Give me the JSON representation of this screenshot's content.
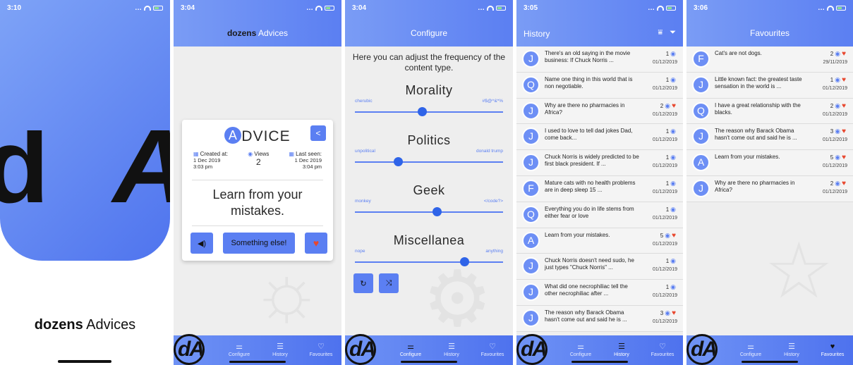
{
  "phone1": {
    "time": "3:10",
    "brand_bold": "dozens",
    "brand_rest": " Advices",
    "big_letters": [
      "d",
      "A"
    ]
  },
  "phone2": {
    "time": "3:04",
    "title_bold": "dozens",
    "title_rest": " Advices",
    "card": {
      "title_initial": "A",
      "title_rest": "DVICE",
      "created_label": "Created at:",
      "created_value_1": "1 Dec 2019",
      "created_value_2": "3:03 pm",
      "views_label": "Views",
      "views_value": "2",
      "last_seen_label": "Last seen:",
      "last_seen_value_1": "1 Dec 2019",
      "last_seen_value_2": "3:04 pm",
      "advice_text": "Learn from your mistakes.",
      "something_else": "Something else!"
    }
  },
  "phone3": {
    "time": "3:04",
    "title": "Configure",
    "intro": "Here you can adjust the frequency of the content type.",
    "sliders": [
      {
        "name": "Morality",
        "low": "cherubic",
        "high": "#$@^&*%",
        "value": 0.45
      },
      {
        "name": "Politics",
        "low": "unpolitical",
        "high": "donald trump",
        "value": 0.29
      },
      {
        "name": "Geek",
        "low": "monkey",
        "high": "</code?>",
        "value": 0.55
      },
      {
        "name": "Miscellanea",
        "low": "nope",
        "high": "anything",
        "value": 0.74
      }
    ]
  },
  "phone4": {
    "time": "3:05",
    "title": "History",
    "items": [
      {
        "initial": "J",
        "text": "There's an old saying in the movie business: If Chuck Norris ...",
        "count": "1",
        "fav": false,
        "date": "01/12/2019"
      },
      {
        "initial": "Q",
        "text": "Name one thing in this world that is non negotiable.",
        "count": "1",
        "fav": false,
        "date": "01/12/2019"
      },
      {
        "initial": "J",
        "text": "Why are there no pharmacies in Africa?",
        "count": "2",
        "fav": true,
        "date": "01/12/2019"
      },
      {
        "initial": "J",
        "text": "I used to love to tell dad jokes Dad, come back...",
        "count": "1",
        "fav": false,
        "date": "01/12/2019"
      },
      {
        "initial": "J",
        "text": "Chuck Norris is widely predicted to be first black president. If ...",
        "count": "1",
        "fav": false,
        "date": "01/12/2019"
      },
      {
        "initial": "F",
        "text": "Mature cats with no health problems are in deep sleep 15 ...",
        "count": "1",
        "fav": false,
        "date": "01/12/2019"
      },
      {
        "initial": "Q",
        "text": "Everything you do in life stems from either fear or love",
        "count": "1",
        "fav": false,
        "date": "01/12/2019"
      },
      {
        "initial": "A",
        "text": "Learn from your mistakes.",
        "count": "5",
        "fav": true,
        "date": "01/12/2019"
      },
      {
        "initial": "J",
        "text": "Chuck Norris doesn't need sudo, he just types \"Chuck Norris\" ...",
        "count": "1",
        "fav": false,
        "date": "01/12/2019"
      },
      {
        "initial": "J",
        "text": "What did one necrophiliac tell the other necrophiliac after ...",
        "count": "1",
        "fav": false,
        "date": "01/12/2019"
      },
      {
        "initial": "J",
        "text": "The reason why Barack Obama hasn't come out and said he is ...",
        "count": "3",
        "fav": true,
        "date": "01/12/2019"
      }
    ]
  },
  "phone5": {
    "time": "3:06",
    "title": "Favourites",
    "items": [
      {
        "initial": "F",
        "text": "Cat's are not dogs.",
        "count": "2",
        "date": "29/11/2019"
      },
      {
        "initial": "J",
        "text": "Little known fact: the greatest taste sensation in the world is ...",
        "count": "1",
        "date": "01/12/2019"
      },
      {
        "initial": "Q",
        "text": "I have a great relationship with the blacks.",
        "count": "2",
        "date": "01/12/2019"
      },
      {
        "initial": "J",
        "text": "The reason why Barack Obama hasn't come out and said he is ...",
        "count": "3",
        "date": "01/12/2019"
      },
      {
        "initial": "A",
        "text": "Learn from your mistakes.",
        "count": "5",
        "date": "01/12/2019"
      },
      {
        "initial": "J",
        "text": "Why are there no pharmacies in Africa?",
        "count": "2",
        "date": "01/12/2019"
      }
    ]
  },
  "tabs": {
    "configure": "Configure",
    "history": "History",
    "favourites": "Favourites"
  },
  "colors": {
    "accent": "#5b7ff2",
    "heart": "#e8472e"
  }
}
